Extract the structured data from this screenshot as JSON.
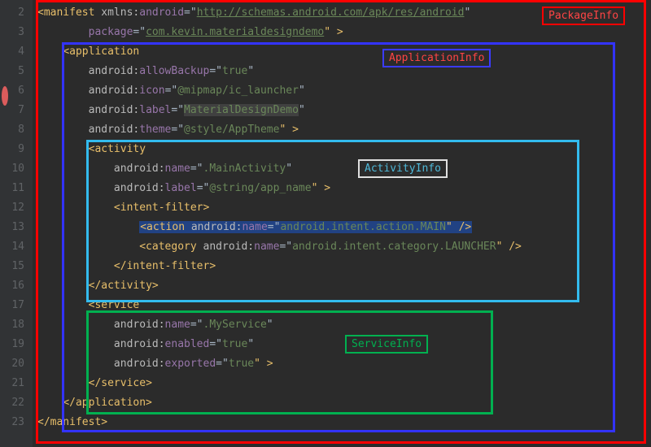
{
  "gutter": [
    "2",
    "3",
    "4",
    "5",
    "6",
    "7",
    "8",
    "9",
    "10",
    "11",
    "12",
    "13",
    "14",
    "15",
    "16",
    "17",
    "18",
    "19",
    "20",
    "21",
    "22",
    "23"
  ],
  "labels": {
    "package": "PackageInfo",
    "application": "ApplicationInfo",
    "activity": "ActivityInfo",
    "service": "ServiceInfo"
  },
  "code": {
    "l2a": "<manifest ",
    "l2b": "xmlns:",
    "l2c": "android",
    "l2d": "=\"",
    "l2e": "http://schemas.android.com/apk/res/android",
    "l2f": "\"",
    "l3a": "package",
    "l3b": "=\"",
    "l3c": "com.kevin.materialdesigndemo",
    "l3d": "\" >",
    "l4": "<application",
    "l5a": "android:",
    "l5b": "allowBackup",
    "l5c": "=\"",
    "l5d": "true",
    "l5e": "\"",
    "l6a": "android:",
    "l6b": "icon",
    "l6c": "=\"",
    "l6d": "@mipmap/ic_launcher",
    "l6e": "\"",
    "l7a": "android:",
    "l7b": "label",
    "l7c": "=\"",
    "l7d": "MaterialDesignDemo",
    "l7e": "\"",
    "l8a": "android:",
    "l8b": "theme",
    "l8c": "=\"",
    "l8d": "@style/AppTheme",
    "l8e": "\" >",
    "l9": "<activity",
    "l10a": "android:",
    "l10b": "name",
    "l10c": "=\"",
    "l10d": ".MainActivity",
    "l10e": "\"",
    "l11a": "android:",
    "l11b": "label",
    "l11c": "=\"",
    "l11d": "@string/app_name",
    "l11e": "\" >",
    "l12": "<intent-filter>",
    "l13a": "<action ",
    "l13b": "android:",
    "l13c": "name",
    "l13d": "=\"",
    "l13e": "android.intent.action.MAIN",
    "l13f": "\" />",
    "l14a": "<category ",
    "l14b": "android:",
    "l14c": "name",
    "l14d": "=\"",
    "l14e": "android.intent.category.LAUNCHER",
    "l14f": "\" />",
    "l15": "</intent-filter>",
    "l16": "</activity>",
    "l17": "<service",
    "l18a": "android:",
    "l18b": "name",
    "l18c": "=\"",
    "l18d": ".MyService",
    "l18e": "\"",
    "l19a": "android:",
    "l19b": "enabled",
    "l19c": "=\"",
    "l19d": "true",
    "l19e": "\"",
    "l20a": "android:",
    "l20b": "exported",
    "l20c": "=\"",
    "l20d": "true",
    "l20e": "\" >",
    "l21": "</service>",
    "l22": "</application>",
    "l23": "</manifest>"
  }
}
